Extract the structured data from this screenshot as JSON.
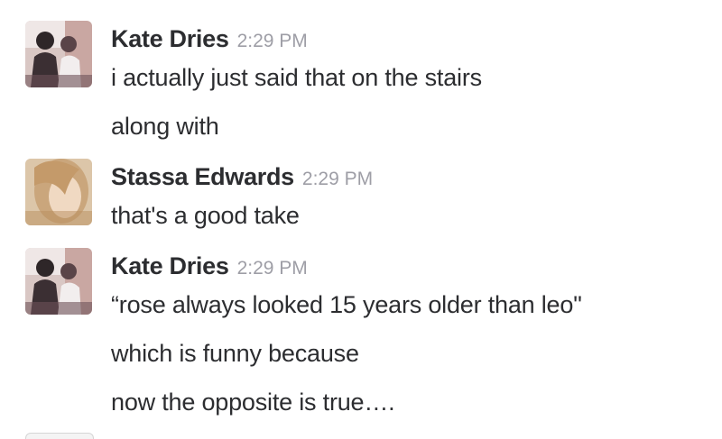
{
  "messages": [
    {
      "sender": "Kate Dries",
      "time": "2:29 PM",
      "avatar_icon": "user-photo-kate",
      "lines": [
        "i actually just said that on the stairs",
        "along with"
      ]
    },
    {
      "sender": "Stassa Edwards",
      "time": "2:29 PM",
      "avatar_icon": "user-photo-stassa",
      "lines": [
        "that's a good take"
      ]
    },
    {
      "sender": "Kate Dries",
      "time": "2:29 PM",
      "avatar_icon": "user-photo-kate",
      "lines": [
        "“rose always looked 15 years older than leo\"",
        "which is funny because",
        "now the opposite is true…."
      ]
    }
  ]
}
